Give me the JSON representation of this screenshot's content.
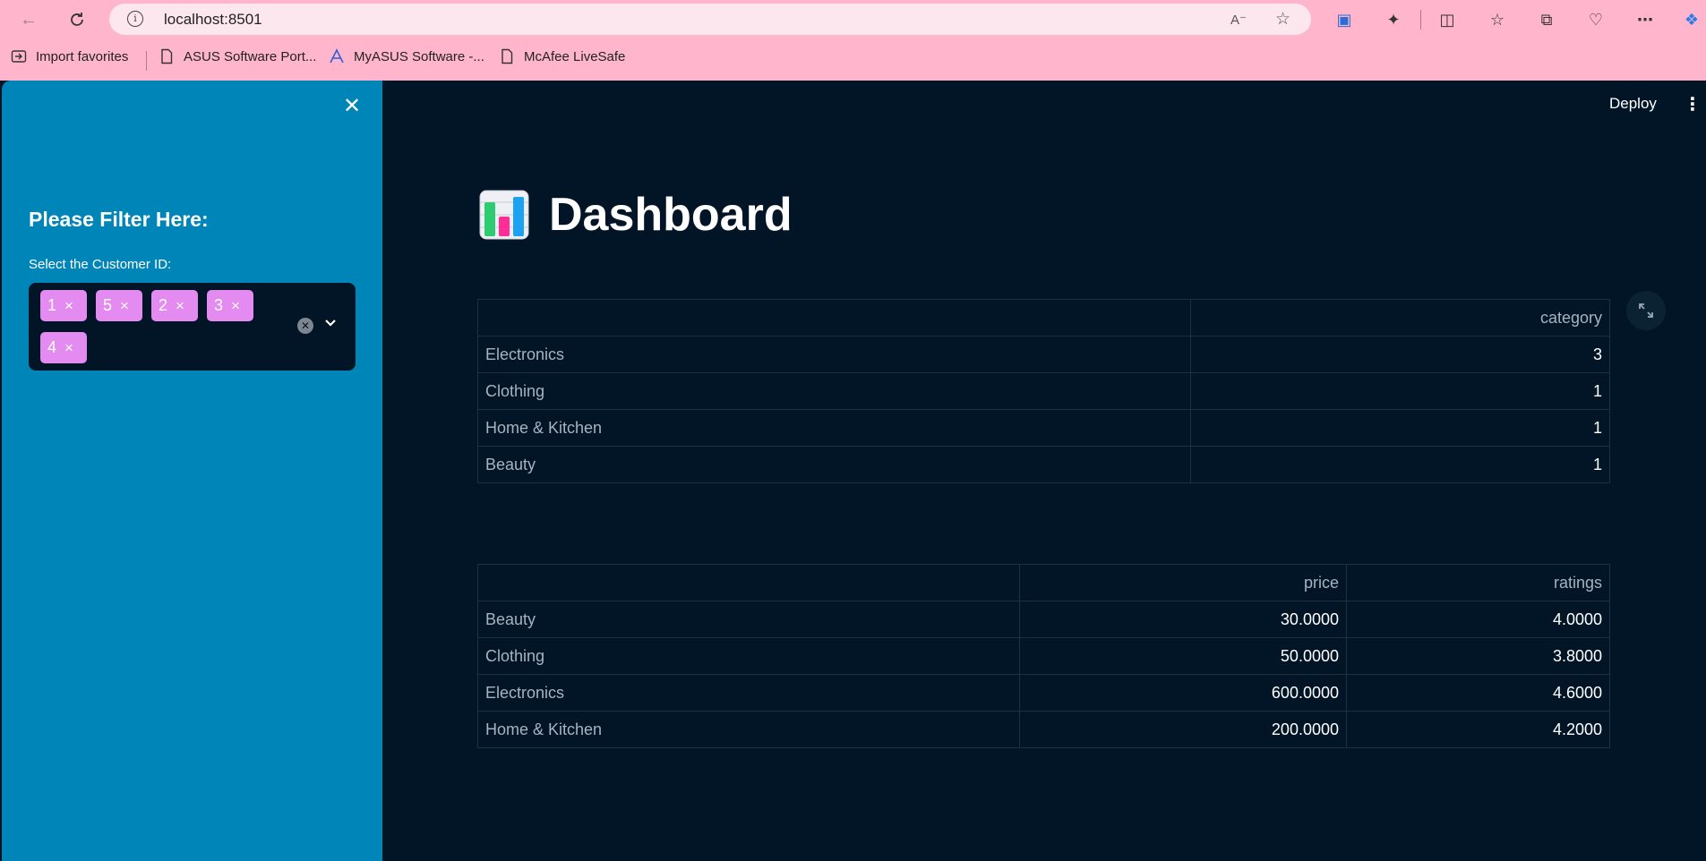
{
  "browser": {
    "url": "localhost:8501",
    "bookmarks": [
      "Import favorites",
      "ASUS Software Port...",
      "MyASUS Software -...",
      "McAfee LiveSafe"
    ]
  },
  "sidebar": {
    "heading": "Please Filter Here:",
    "filter_label": "Select the Customer ID:",
    "selected_ids": [
      "1",
      "5",
      "2",
      "3",
      "4"
    ],
    "tag_remove_glyph": "×"
  },
  "header": {
    "deploy_label": "Deploy"
  },
  "main": {
    "title": "Dashboard",
    "category_table": {
      "columns": [
        "",
        "category"
      ],
      "rows": [
        {
          "index": "Electronics",
          "category": "3"
        },
        {
          "index": "Clothing",
          "category": "1"
        },
        {
          "index": "Home & Kitchen",
          "category": "1"
        },
        {
          "index": "Beauty",
          "category": "1"
        }
      ]
    },
    "price_table": {
      "columns": [
        "",
        "price",
        "ratings"
      ],
      "rows": [
        {
          "index": "Beauty",
          "price": "30.0000",
          "ratings": "4.0000"
        },
        {
          "index": "Clothing",
          "price": "50.0000",
          "ratings": "3.8000"
        },
        {
          "index": "Electronics",
          "price": "600.0000",
          "ratings": "4.6000"
        },
        {
          "index": "Home & Kitchen",
          "price": "200.0000",
          "ratings": "4.2000"
        }
      ]
    }
  },
  "colors": {
    "browser_chrome": "#ffb6cc",
    "sidebar_bg": "#0085b9",
    "main_bg": "#011526",
    "tag_bg": "#e38bf0"
  }
}
